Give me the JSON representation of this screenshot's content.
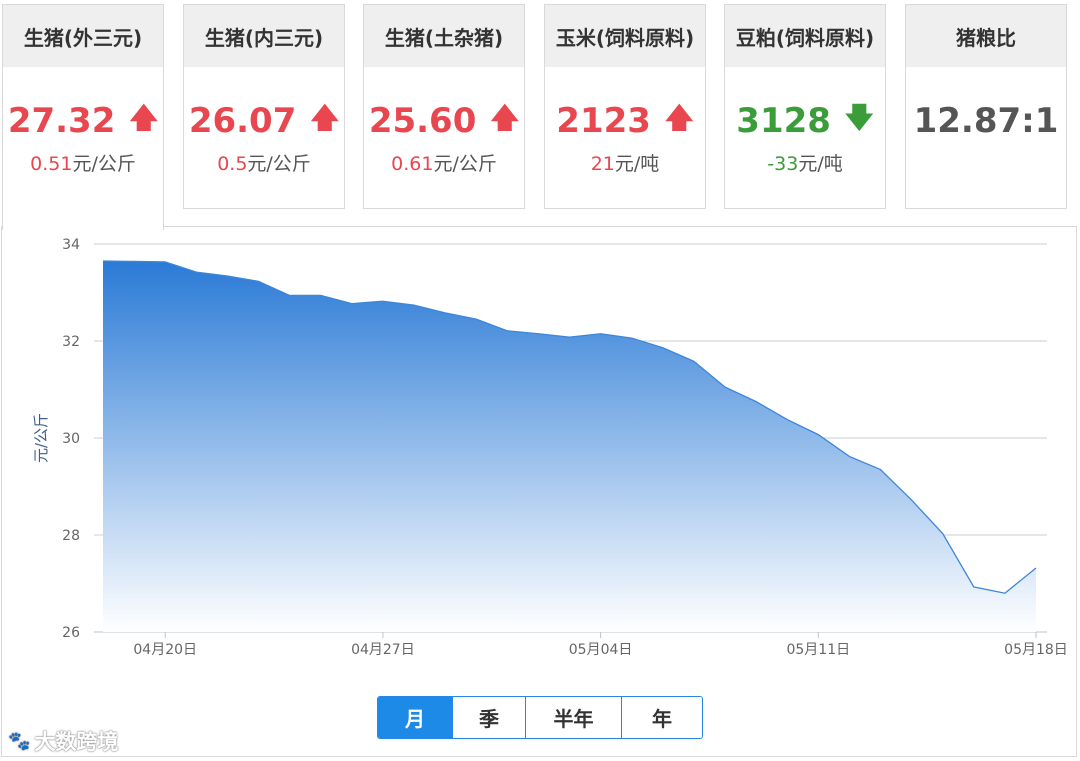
{
  "cards": [
    {
      "title": "生猪(外三元)",
      "value": "27.32",
      "direction": "up",
      "arrow": "🡅",
      "change": "0.51",
      "unit": "元/公斤"
    },
    {
      "title": "生猪(内三元)",
      "value": "26.07",
      "direction": "up",
      "arrow": "🡅",
      "change": "0.5",
      "unit": "元/公斤"
    },
    {
      "title": "生猪(土杂猪)",
      "value": "25.60",
      "direction": "up",
      "arrow": "🡅",
      "change": "0.61",
      "unit": "元/公斤"
    },
    {
      "title": "玉米(饲料原料)",
      "value": "2123",
      "direction": "up",
      "arrow": "🡅",
      "change": "21",
      "unit": "元/吨"
    },
    {
      "title": "豆粕(饲料原料)",
      "value": "3128",
      "direction": "down",
      "arrow": "🡇",
      "change": "-33",
      "unit": "元/吨"
    },
    {
      "title": "猪粮比",
      "value": "12.87:1",
      "direction": "none",
      "arrow": "",
      "change": "",
      "unit": ""
    }
  ],
  "colors": {
    "up": "#e8474f",
    "down": "#3a9d3a",
    "accent": "#1e8ae8",
    "area_top": "#2a7ad6",
    "line": "#3d86d8"
  },
  "tabs": [
    {
      "label": "月",
      "active": true
    },
    {
      "label": "季",
      "active": false
    },
    {
      "label": "半年",
      "active": false
    },
    {
      "label": "年",
      "active": false
    }
  ],
  "watermark": {
    "logo": "🐾",
    "text": "大数跨境"
  },
  "chart_data": {
    "type": "area",
    "title": "",
    "xlabel": "",
    "ylabel": "元/公斤",
    "ylim": [
      26,
      34
    ],
    "yticks": [
      26,
      28,
      30,
      32,
      34
    ],
    "x_tick_labels": [
      "04月20日",
      "04月27日",
      "05月04日",
      "05月11日",
      "05月18日"
    ],
    "x_tick_index": [
      2,
      9,
      16,
      23,
      30
    ],
    "grid": true,
    "x": [
      "04月18日",
      "04月19日",
      "04月20日",
      "04月21日",
      "04月22日",
      "04月23日",
      "04月24日",
      "04月25日",
      "04月26日",
      "04月27日",
      "04月28日",
      "04月29日",
      "04月30日",
      "05月01日",
      "05月02日",
      "05月03日",
      "05月04日",
      "05月05日",
      "05月06日",
      "05月07日",
      "05月08日",
      "05月09日",
      "05月10日",
      "05月11日",
      "05月12日",
      "05月13日",
      "05月14日",
      "05月15日",
      "05月16日",
      "05月17日",
      "05月18日"
    ],
    "values": [
      33.65,
      33.64,
      33.63,
      33.42,
      33.34,
      33.23,
      32.94,
      32.94,
      32.77,
      32.82,
      32.74,
      32.58,
      32.45,
      32.21,
      32.15,
      32.08,
      32.15,
      32.06,
      31.86,
      31.58,
      31.05,
      30.75,
      30.38,
      30.07,
      29.62,
      29.35,
      28.72,
      28.03,
      26.93,
      26.8,
      27.32
    ]
  }
}
